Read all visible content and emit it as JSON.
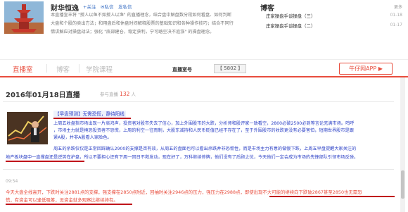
{
  "header": {
    "host_name": "财华恒逸",
    "follow": "+关注",
    "message": "✉私信",
    "quiz": "发私信",
    "intro": [
      "本直播宣丰将 \"授人以鱼不如授人以渔\" 的直播理念，结合盘中解盘数分段如何看盘、如何判断",
      "大盘和个股的卖出方法；和用盘后和休盘时间解释股票的基础知识和各种操作技巧；结合不同行",
      "情讲解应对操盘战法；强化 \"底部建仓，稳定获利，宁可踏空决不追涨\" 的操盘理念。"
    ]
  },
  "blog": {
    "title": "博客",
    "more": "更多",
    "items": [
      {
        "label": "庄家操盘手谈操盘（三）",
        "date": "01-18"
      },
      {
        "label": "庄家操盘手谈操盘（二）",
        "date": "01-17"
      }
    ]
  },
  "nav": {
    "tabs": [
      "直播室",
      "博客",
      "学院课程"
    ],
    "room_label": "直播室号",
    "room_number": "【 5802 】",
    "app_button": "牛仔网APP ▶"
  },
  "live": {
    "date_title": "2016年01月18日直播",
    "participants_label": "参与直播",
    "participants_count": "132",
    "participants_unit": "人"
  },
  "post1": {
    "headline": "【早盘预测】无需恐慌，静待阳线",
    "lines": [
      "上周五收盘指市场出现一片哀鸿声，投资者对股市失去了信心，加上外围股市的大跌，分析师和股评家一致看空，2800必破2500必到等言论充满市场。鸣呼",
      "，市场主力就是掩恐投资者不恐慌，上周的利空一往而制，大股东减持和人民币贬值已经不存在了，至于外围股市的收跌更没有必要害怕，短期世界股市是跟",
      "紧A股，并非A股看人家脸色。",
      "    周五的杀跌仅仅是正常回踩确认2900的支撑是否有效，从周五的盘面也可以看出杀跌并非恐慌性，而是市场主力有意的做慢下跌，上周五早盘提醒大家关注的",
      "地产板块盘中一直撑盘还是逆势在护盘，所以不要担心还有下周一回日不救发动，现在好了，万科继续停牌，他们没有了后顾之忧，今天他们一定会成为市场的先锋部队引领市场反弹。"
    ]
  },
  "post2": {
    "time": "09:54",
    "lines": [
      "今天大盘全线高开，下跌时关注2881点的支撑，强支撑在2850点附近，回抽时关注2946点的压力，强压力在2988点，即使出现不大可能的继续向下跌破2867甚至2850也无需恐",
      "慌，有资金可以逢低吸筹，没资金就多观察比继续持有。"
    ]
  },
  "colors": {
    "accent": "#e84d3d",
    "link_blue": "#2c41c6",
    "underline_red": "#c0141a"
  }
}
